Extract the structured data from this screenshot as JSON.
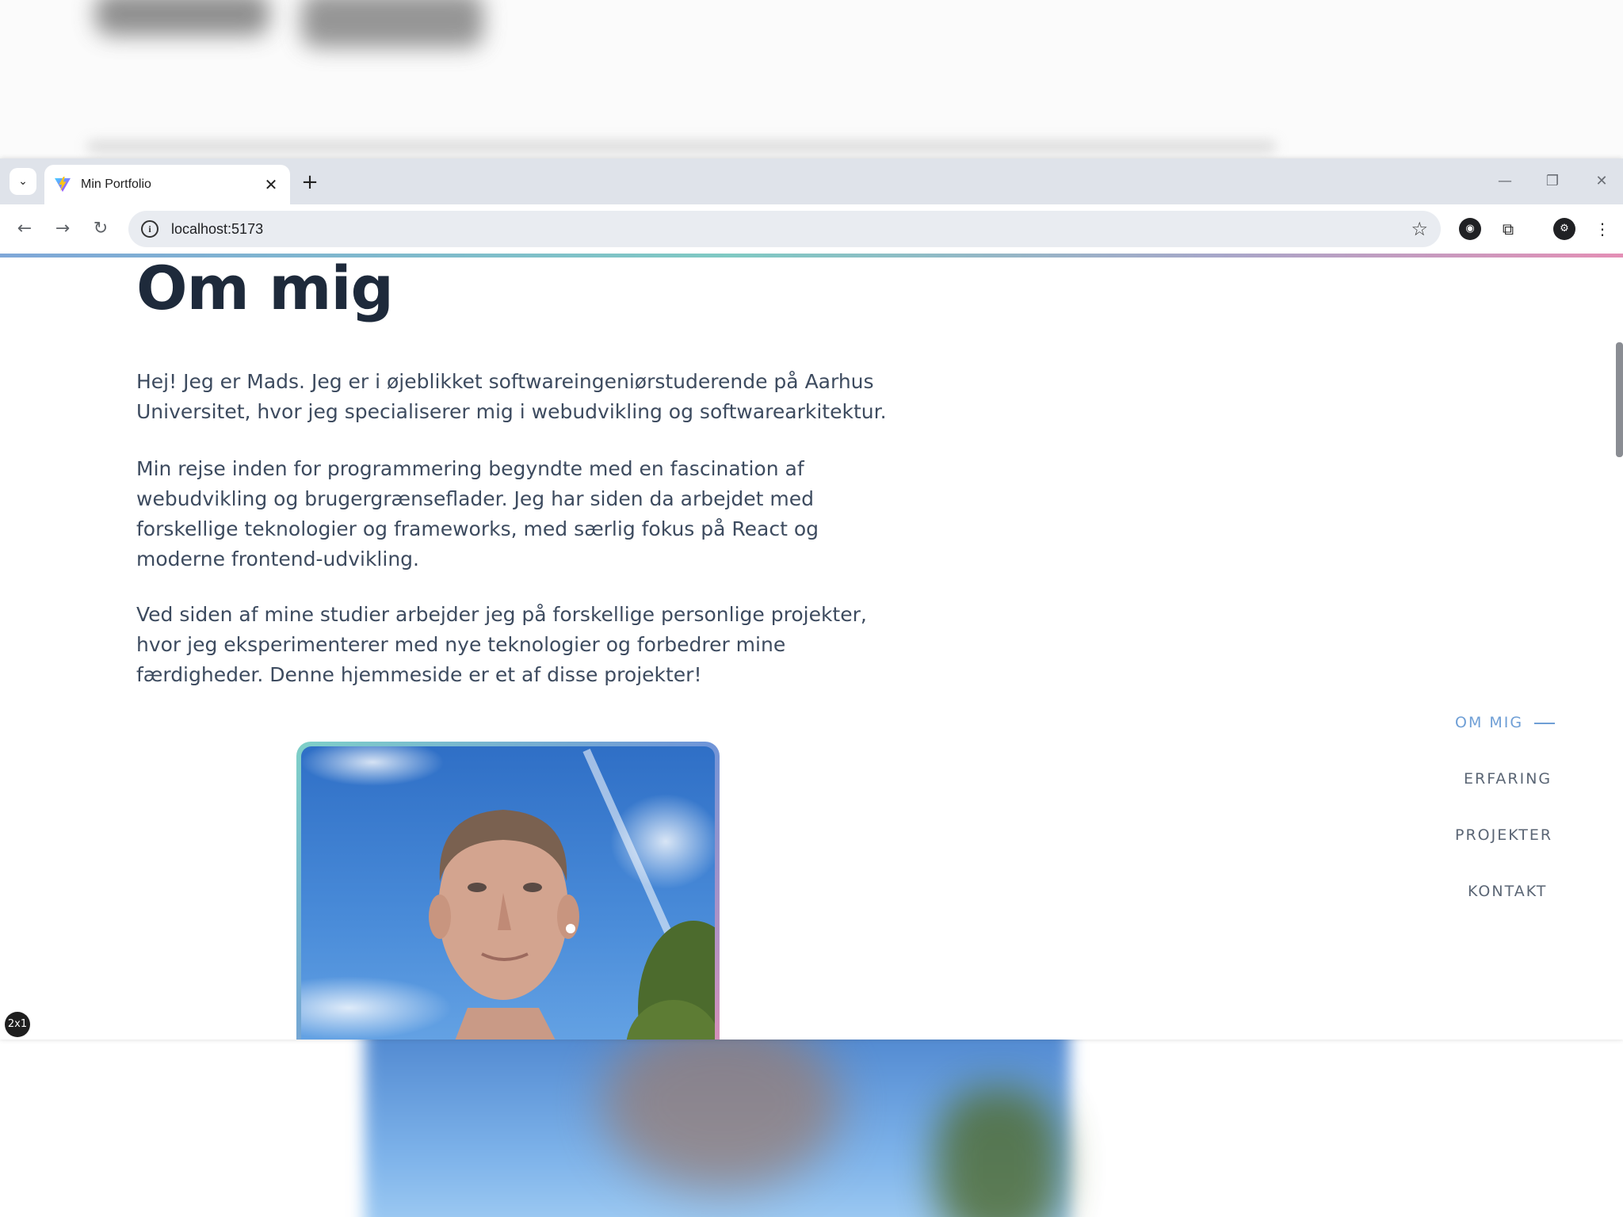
{
  "browser": {
    "tab_title": "Min Portfolio",
    "url": "localhost:5173",
    "tab_close_icon": "close-icon",
    "new_tab_icon": "plus-icon"
  },
  "page": {
    "heading": "Om mig",
    "paragraphs": [
      "Hej! Jeg er Mads. Jeg er i øjeblikket softwareingeniørstuderende på Aarhus Universitet, hvor jeg specialiserer mig i webudvikling og softwarearkitektur.",
      "Min rejse inden for programmering begyndte med en fascination af webudvikling og brugergrænseflader. Jeg har siden da arbejdet med forskellige teknologier og frameworks, med særlig fokus på React og moderne frontend-udvikling.",
      "Ved siden af mine studier arbejder jeg på forskellige personlige projekter, hvor jeg eksperimenterer med nye teknologier og forbedrer mine færdigheder. Denne hjemmeside er et af disse projekter!"
    ],
    "nav": [
      {
        "label": "OM MIG",
        "active": true
      },
      {
        "label": "ERFARING",
        "active": false
      },
      {
        "label": "PROJEKTER",
        "active": false
      },
      {
        "label": "KONTAKT",
        "active": false
      }
    ],
    "badge": "2x1"
  },
  "colors": {
    "heading": "#1e2a3b",
    "text": "#3d4b5f",
    "nav_active": "#6f9fd6",
    "nav_inactive": "#5b6675"
  }
}
